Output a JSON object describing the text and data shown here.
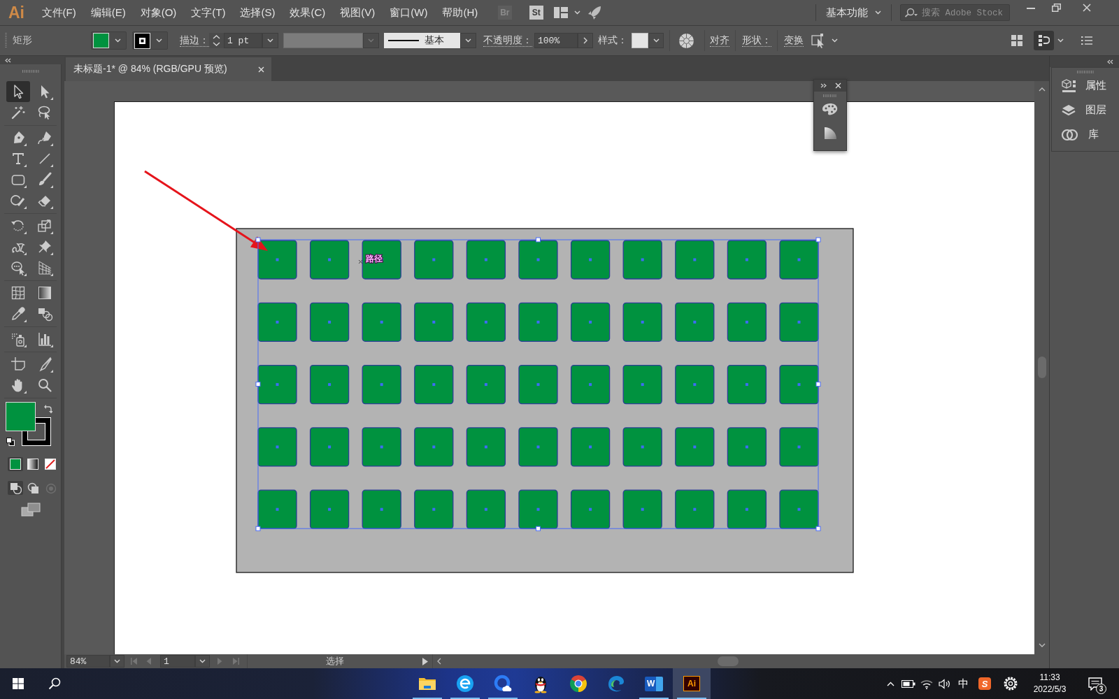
{
  "menu_bar": {
    "logo": "Ai",
    "items": [
      "文件(F)",
      "编辑(E)",
      "对象(O)",
      "文字(T)",
      "选择(S)",
      "效果(C)",
      "视图(V)",
      "窗口(W)",
      "帮助(H)"
    ],
    "app_buttons": [
      {
        "label": "Br",
        "disabled": true
      },
      {
        "label": "St",
        "disabled": false
      }
    ],
    "workspace": "基本功能",
    "search": {
      "placeholder": "搜索 Adobe Stock"
    }
  },
  "control_bar": {
    "object_type": "矩形",
    "fill": {
      "color": "#00923f"
    },
    "stroke": {
      "color": "#000000"
    },
    "stroke_label": "描边：",
    "stroke_weight": "1 pt",
    "stroke_style": "基本",
    "opacity_label": "不透明度：",
    "opacity": "100%",
    "style_label": "样式：",
    "links": [
      "对齐",
      "形状：",
      "变换"
    ],
    "view_buttons": [
      {
        "kind": "grid",
        "selected": false
      },
      {
        "kind": "dock",
        "selected": true
      }
    ]
  },
  "document_tab": {
    "title": "未标题-1* @ 84% (RGB/GPU 预览)",
    "selected": true
  },
  "toolbar": {
    "groups": [
      [
        {
          "kind": "selection",
          "selected": true
        },
        {
          "kind": "direct_selection",
          "selected": false
        },
        {
          "kind": "magic_wand",
          "selected": false
        },
        {
          "kind": "lasso",
          "selected": false
        }
      ],
      [
        {
          "kind": "pen",
          "selected": false
        },
        {
          "kind": "curvature",
          "selected": false
        },
        {
          "kind": "type",
          "selected": false
        },
        {
          "kind": "line",
          "selected": false
        },
        {
          "kind": "rectangle",
          "selected": false
        },
        {
          "kind": "paintbrush",
          "selected": false
        },
        {
          "kind": "shaper",
          "selected": false
        },
        {
          "kind": "eraser",
          "selected": false
        }
      ],
      [
        {
          "kind": "rotate",
          "selected": false
        },
        {
          "kind": "scale",
          "selected": false
        },
        {
          "kind": "warp",
          "selected": false
        },
        {
          "kind": "puppet_warp",
          "selected": false
        },
        {
          "kind": "shape_builder",
          "selected": false
        },
        {
          "kind": "perspective_grid",
          "selected": false
        }
      ],
      [
        {
          "kind": "mesh",
          "selected": false
        },
        {
          "kind": "gradient",
          "selected": false
        },
        {
          "kind": "eyedropper",
          "selected": false
        },
        {
          "kind": "blend",
          "selected": false
        }
      ],
      [
        {
          "kind": "symbol_sprayer",
          "selected": false
        },
        {
          "kind": "column_graph",
          "selected": false
        }
      ],
      [
        {
          "kind": "artboard",
          "selected": false
        },
        {
          "kind": "slice",
          "selected": false
        },
        {
          "kind": "hand",
          "selected": false
        },
        {
          "kind": "zoom",
          "selected": false
        }
      ]
    ],
    "fill": {
      "color": "#00923f"
    },
    "stroke": {
      "color": "#000000"
    },
    "color_modes": [
      {
        "kind": "color",
        "selected": true
      },
      {
        "kind": "gradient",
        "selected": false
      },
      {
        "kind": "none",
        "selected": false
      }
    ],
    "draw_modes": [
      {
        "kind": "normal",
        "selected": true,
        "disabled": false
      },
      {
        "kind": "behind",
        "selected": false,
        "disabled": false
      },
      {
        "kind": "inside",
        "selected": false,
        "disabled": true
      }
    ]
  },
  "artwork": {
    "square_rows": [
      [
        {
          "selected": true
        },
        {
          "selected": true
        },
        {
          "selected": true
        },
        {
          "selected": true
        },
        {
          "selected": true
        },
        {
          "selected": true
        },
        {
          "selected": true
        },
        {
          "selected": true
        },
        {
          "selected": true
        },
        {
          "selected": true
        },
        {
          "selected": true
        }
      ],
      [
        {
          "selected": true
        },
        {
          "selected": true
        },
        {
          "selected": true
        },
        {
          "selected": true
        },
        {
          "selected": true
        },
        {
          "selected": true
        },
        {
          "selected": true
        },
        {
          "selected": true
        },
        {
          "selected": true
        },
        {
          "selected": true
        },
        {
          "selected": true
        }
      ],
      [
        {
          "selected": true
        },
        {
          "selected": true
        },
        {
          "selected": true
        },
        {
          "selected": true
        },
        {
          "selected": true
        },
        {
          "selected": true
        },
        {
          "selected": true
        },
        {
          "selected": true
        },
        {
          "selected": true
        },
        {
          "selected": true
        },
        {
          "selected": true
        }
      ],
      [
        {
          "selected": true
        },
        {
          "selected": true
        },
        {
          "selected": true
        },
        {
          "selected": true
        },
        {
          "selected": true
        },
        {
          "selected": true
        },
        {
          "selected": true
        },
        {
          "selected": true
        },
        {
          "selected": true
        },
        {
          "selected": true
        },
        {
          "selected": true
        }
      ],
      [
        {
          "selected": true
        },
        {
          "selected": true
        },
        {
          "selected": true
        },
        {
          "selected": true
        },
        {
          "selected": true
        },
        {
          "selected": true
        },
        {
          "selected": true
        },
        {
          "selected": true
        },
        {
          "selected": true
        },
        {
          "selected": true
        },
        {
          "selected": true
        }
      ]
    ],
    "hover_label": "路径"
  },
  "floating_panel": {
    "items": [
      {
        "kind": "palette"
      },
      {
        "kind": "quarter_circle"
      }
    ]
  },
  "side_panel": {
    "items": [
      {
        "kind": "properties",
        "label": "属性"
      },
      {
        "kind": "layers",
        "label": "图层"
      },
      {
        "kind": "libraries",
        "label": "库"
      }
    ]
  },
  "status_bar": {
    "zoom": "84%",
    "page": "1",
    "page_nav": [
      {
        "kind": "first",
        "disabled": true
      },
      {
        "kind": "previous",
        "disabled": true
      },
      {
        "kind": "next",
        "disabled": true
      },
      {
        "kind": "last",
        "disabled": true
      }
    ],
    "status": "选择"
  },
  "taskbar": {
    "apps": [
      {
        "kind": "folder",
        "running": true,
        "selected": false
      },
      {
        "kind": "e_circle",
        "running": true,
        "selected": false
      },
      {
        "kind": "ring_cloud",
        "running": true,
        "selected": false
      },
      {
        "kind": "penguin",
        "running": false,
        "selected": false
      },
      {
        "kind": "segmented_circle",
        "running": false,
        "selected": false
      },
      {
        "kind": "wave",
        "running": false,
        "selected": false
      },
      {
        "kind": "word",
        "label": "W",
        "running": true,
        "selected": false
      },
      {
        "kind": "illustrator",
        "label": "Ai",
        "running": true,
        "selected": true
      }
    ],
    "tray": {
      "input_method": "中",
      "input_logo": "S",
      "time": "11:33",
      "date": "2022/5/3",
      "notifications": "3"
    }
  }
}
